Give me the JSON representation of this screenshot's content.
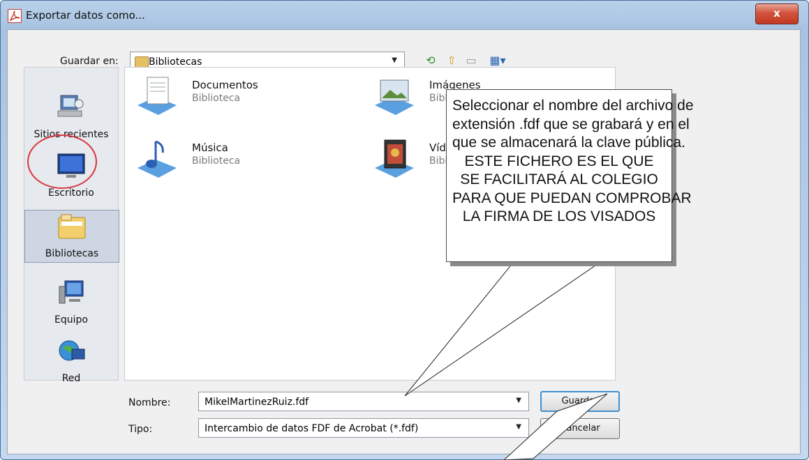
{
  "window": {
    "title": "Exportar datos como...",
    "close_label": "x"
  },
  "save_in": {
    "label": "Guardar en:",
    "value": "Bibliotecas"
  },
  "places": [
    {
      "label": "Sitios recientes",
      "icon": "recent-places-icon"
    },
    {
      "label": "Escritorio",
      "icon": "desktop-icon"
    },
    {
      "label": "Bibliotecas",
      "icon": "libraries-icon",
      "selected": true
    },
    {
      "label": "Equipo",
      "icon": "computer-icon"
    },
    {
      "label": "Red",
      "icon": "network-icon"
    }
  ],
  "files": [
    {
      "name": "Documentos",
      "type": "Biblioteca",
      "icon": "documents-library-icon"
    },
    {
      "name": "Imágenes",
      "type": "Biblioteca",
      "icon": "pictures-library-icon"
    },
    {
      "name": "Música",
      "type": "Biblioteca",
      "icon": "music-library-icon"
    },
    {
      "name": "Vídeos",
      "type": "Biblioteca",
      "icon": "videos-library-icon"
    }
  ],
  "filename": {
    "label": "Nombre:",
    "value": "MikelMartinezRuiz.fdf"
  },
  "filetype": {
    "label": "Tipo:",
    "value": "Intercambio de datos FDF de Acrobat (*.fdf)"
  },
  "buttons": {
    "save": "Guardar",
    "cancel": "Cancelar"
  },
  "callout": {
    "lines": [
      "Seleccionar el nombre del archivo de",
      "extensión .fdf que se grabará y en el",
      "que se almacenará la clave pública.",
      "ESTE FICHERO ES EL QUE",
      "SE FACILITARÁ AL COLEGIO",
      "PARA QUE PUEDAN COMPROBAR",
      "LA FIRMA DE LOS VISADOS"
    ]
  },
  "colors": {
    "accent": "#3d8fcf",
    "highlight_circle": "#d9363e",
    "close": "#c23a22"
  }
}
